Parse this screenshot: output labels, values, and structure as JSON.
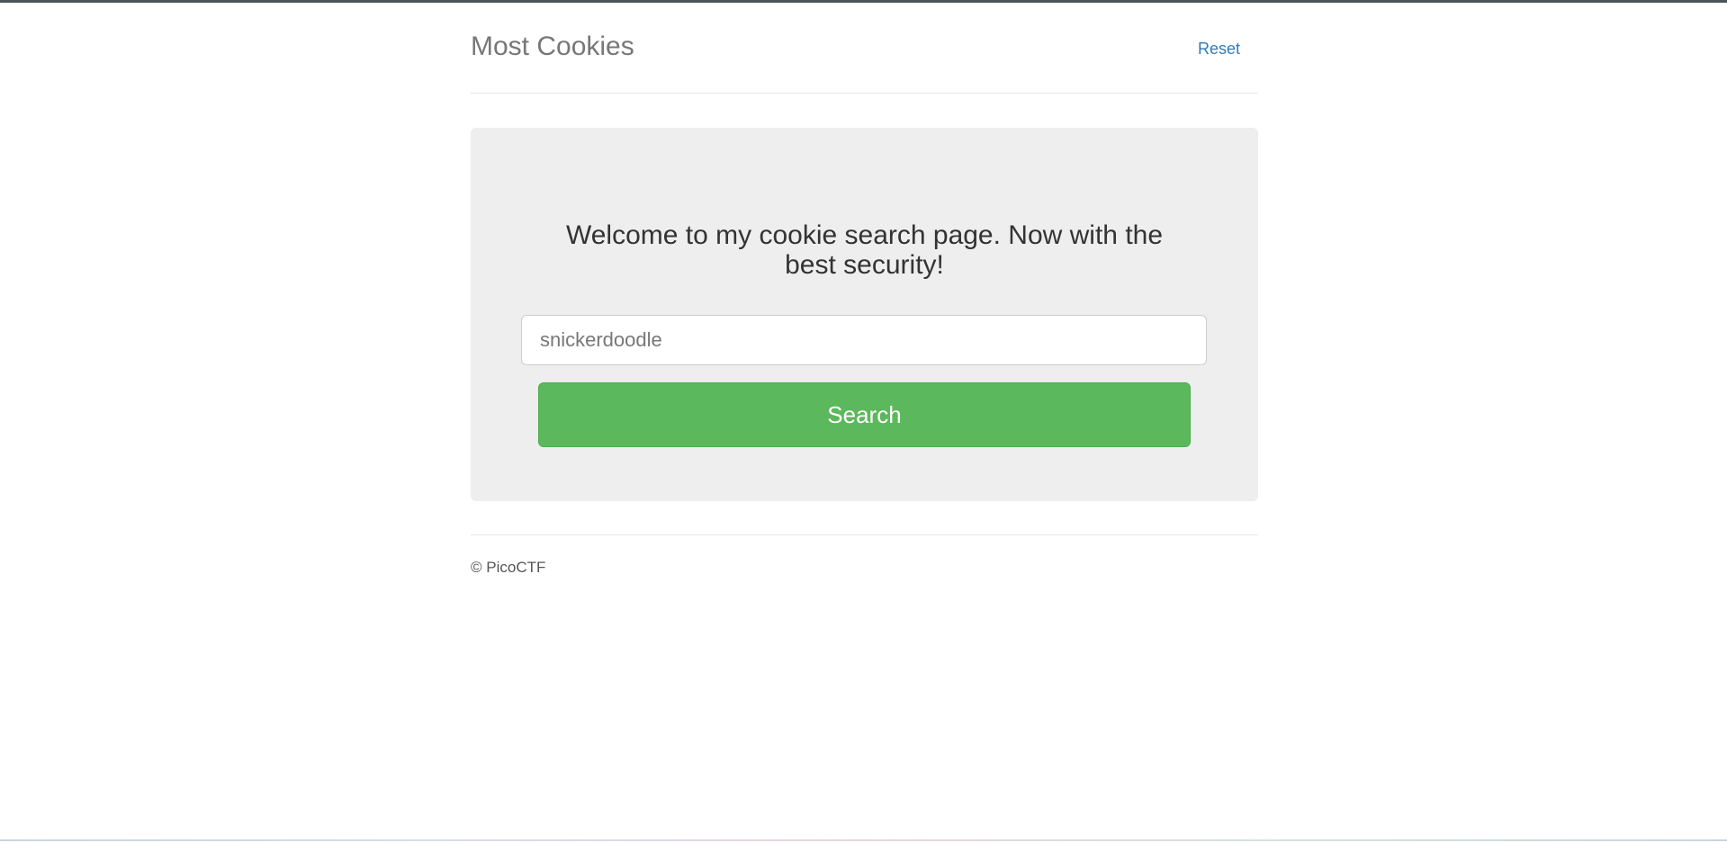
{
  "header": {
    "title": "Most Cookies",
    "reset_label": "Reset"
  },
  "main": {
    "welcome_line1": "Welcome to my cookie search page. Now with the",
    "welcome_line2": "best security!",
    "search": {
      "placeholder": "snickerdoodle",
      "value": ""
    },
    "search_button_label": "Search"
  },
  "footer": {
    "copyright": "© PicoCTF"
  },
  "colors": {
    "accent_green": "#5cb85c",
    "link_blue": "#337ab7",
    "panel_gray": "#eeeeee"
  }
}
